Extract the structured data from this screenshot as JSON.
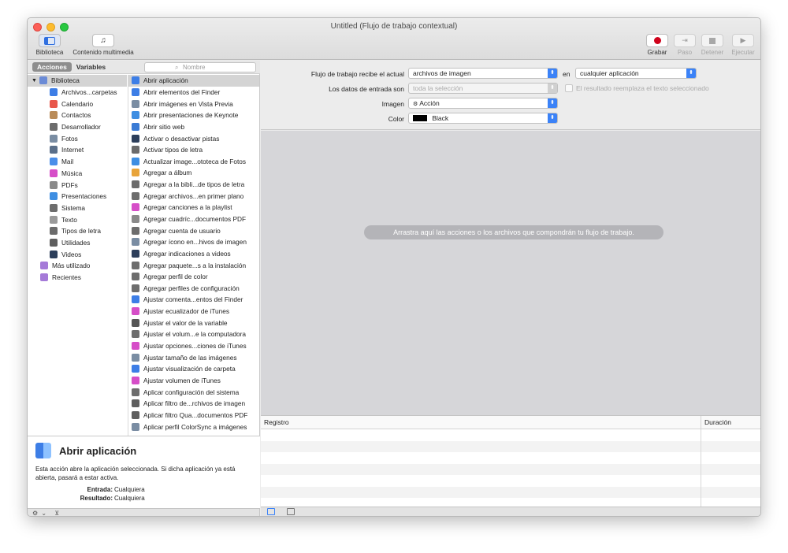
{
  "window": {
    "title": "Untitled (Flujo de trabajo contextual)"
  },
  "toolbar": {
    "library": "Biblioteca",
    "media": "Contenido multimedia",
    "record": "Grabar",
    "step": "Paso",
    "stop": "Detener",
    "run": "Ejecutar"
  },
  "tabs": {
    "actions": "Acciones",
    "variables": "Variables"
  },
  "search": {
    "placeholder": "Nombre"
  },
  "library": {
    "root": "Biblioteca",
    "items": [
      {
        "label": "Archivos...carpetas",
        "color": "#3d7ee6"
      },
      {
        "label": "Calendario",
        "color": "#e8574a"
      },
      {
        "label": "Contactos",
        "color": "#b98b58"
      },
      {
        "label": "Desarrollador",
        "color": "#6c6c6c"
      },
      {
        "label": "Fotos",
        "color": "#7a8da3"
      },
      {
        "label": "Internet",
        "color": "#5a6f8a"
      },
      {
        "label": "Mail",
        "color": "#4a8ee9"
      },
      {
        "label": "Música",
        "color": "#d64ec8"
      },
      {
        "label": "PDFs",
        "color": "#8a8a8a"
      },
      {
        "label": "Presentaciones",
        "color": "#3e8ee2"
      },
      {
        "label": "Sistema",
        "color": "#6d6d6d"
      },
      {
        "label": "Texto",
        "color": "#9a9a9a"
      },
      {
        "label": "Tipos de letra",
        "color": "#6b6b6b"
      },
      {
        "label": "Utilidades",
        "color": "#5e5e5e"
      },
      {
        "label": "Videos",
        "color": "#2c3e5a"
      }
    ],
    "extras": [
      {
        "label": "Más utilizado",
        "color": "#a57ad8"
      },
      {
        "label": "Recientes",
        "color": "#a57ad8"
      }
    ]
  },
  "actions": [
    {
      "label": "Abrir aplicación",
      "color": "#3d7ee6"
    },
    {
      "label": "Abrir elementos del Finder",
      "color": "#3d7ee6"
    },
    {
      "label": "Abrir imágenes en Vista Previa",
      "color": "#7a8da3"
    },
    {
      "label": "Abrir presentaciones de Keynote",
      "color": "#3e8ee2"
    },
    {
      "label": "Abrir sitio web",
      "color": "#3a7bd5"
    },
    {
      "label": "Activar o desactivar pistas",
      "color": "#2c3e5a"
    },
    {
      "label": "Activar tipos de letra",
      "color": "#6b6b6b"
    },
    {
      "label": "Actualizar image...ototeca de Fotos",
      "color": "#3e8ee2"
    },
    {
      "label": "Agregar a álbum",
      "color": "#e8a43a"
    },
    {
      "label": "Agregar a la bibli...de tipos de letra",
      "color": "#6b6b6b"
    },
    {
      "label": "Agregar archivos...en primer plano",
      "color": "#6d6d6d"
    },
    {
      "label": "Agregar canciones a la playlist",
      "color": "#d64ec8"
    },
    {
      "label": "Agregar cuadríc...documentos PDF",
      "color": "#8a8a8a"
    },
    {
      "label": "Agregar cuenta de usuario",
      "color": "#6d6d6d"
    },
    {
      "label": "Agregar ícono en...hivos de imagen",
      "color": "#7a8da3"
    },
    {
      "label": "Agregar indicaciones a videos",
      "color": "#2c3e5a"
    },
    {
      "label": "Agregar paquete...s a la instalación",
      "color": "#6d6d6d"
    },
    {
      "label": "Agregar perfil de color",
      "color": "#6d6d6d"
    },
    {
      "label": "Agregar perfiles de configuración",
      "color": "#6d6d6d"
    },
    {
      "label": "Ajustar comenta...entos del Finder",
      "color": "#3d7ee6"
    },
    {
      "label": "Ajustar ecualizador de iTunes",
      "color": "#d64ec8"
    },
    {
      "label": "Ajustar el valor de la variable",
      "color": "#555555"
    },
    {
      "label": "Ajustar el volum...e la computadora",
      "color": "#6d6d6d"
    },
    {
      "label": "Ajustar opciones...ciones de iTunes",
      "color": "#d64ec8"
    },
    {
      "label": "Ajustar tamaño de las imágenes",
      "color": "#7a8da3"
    },
    {
      "label": "Ajustar visualización de carpeta",
      "color": "#3d7ee6"
    },
    {
      "label": "Ajustar volumen de iTunes",
      "color": "#d64ec8"
    },
    {
      "label": "Aplicar configuración del sistema",
      "color": "#6d6d6d"
    },
    {
      "label": "Aplicar filtro de...rchivos de imagen",
      "color": "#5e5e5e"
    },
    {
      "label": "Aplicar filtro Qua...documentos PDF",
      "color": "#5e5e5e"
    },
    {
      "label": "Aplicar perfil ColorSync a imágenes",
      "color": "#7a8da3"
    }
  ],
  "description": {
    "title": "Abrir aplicación",
    "text": "Esta acción abre la aplicación seleccionada. Si dicha aplicación ya está abierta, pasará a estar activa.",
    "input_label": "Entrada:",
    "input_value": "Cualquiera",
    "result_label": "Resultado:",
    "result_value": "Cualquiera"
  },
  "params": {
    "receives_label": "Flujo de trabajo recibe el actual",
    "receives_value": "archivos de imagen",
    "in_label": "en",
    "app_value": "cualquier aplicación",
    "input_label": "Los datos de entrada son",
    "input_value": "toda la selección",
    "replace_label": "El resultado reemplaza el texto seleccionado",
    "image_label": "Imagen",
    "image_value": "Acción",
    "color_label": "Color",
    "color_value": "Black",
    "color_swatch": "#000000"
  },
  "drop_hint": "Arrastra aquí las acciones o los archivos que compondrán tu flujo de trabajo.",
  "log": {
    "col1": "Registro",
    "col2": "Duración"
  },
  "colors": {
    "accent": "#3b82f7",
    "record": "#d0021b"
  }
}
